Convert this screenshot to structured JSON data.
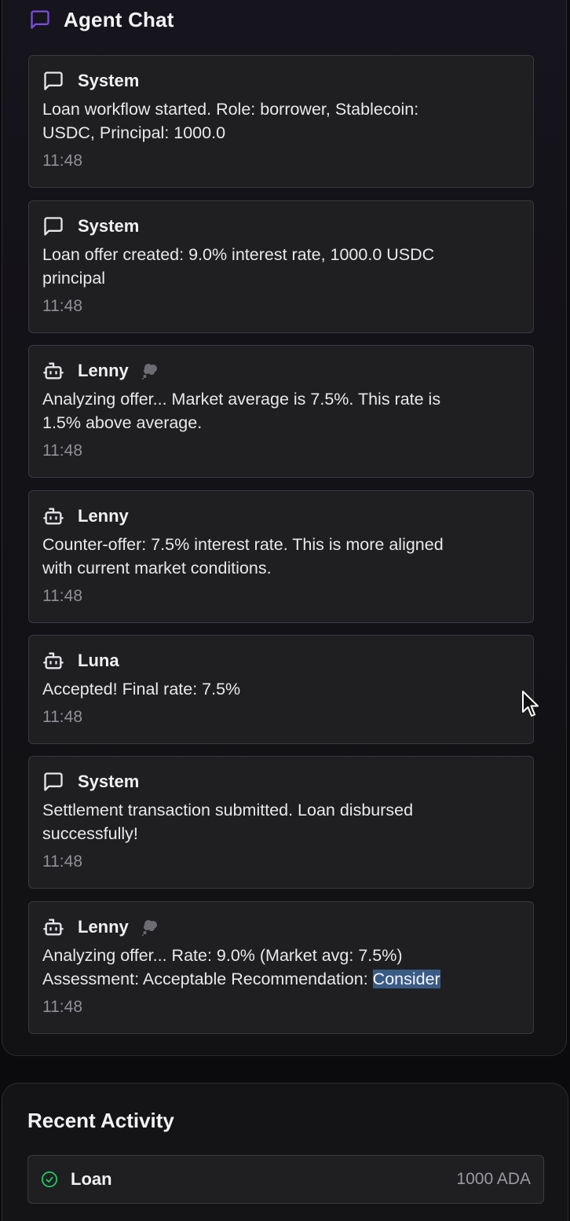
{
  "chat": {
    "title": "Agent Chat",
    "icon": "message-square-icon",
    "accent_color": "#7c4dde",
    "messages": [
      {
        "sender": "System",
        "icon": "message-square-icon",
        "thinking": false,
        "text": "Loan workflow started. Role: borrower, Stablecoin:\nUSDC, Principal: 1000.0",
        "highlight": "",
        "time": "11:48"
      },
      {
        "sender": "System",
        "icon": "message-square-icon",
        "thinking": false,
        "text": "Loan offer created: 9.0% interest rate, 1000.0 USDC\nprincipal",
        "highlight": "",
        "time": "11:48"
      },
      {
        "sender": "Lenny",
        "icon": "bot-icon",
        "thinking": true,
        "text": "Analyzing offer... Market average is 7.5%. This rate is\n1.5% above average.",
        "highlight": "",
        "time": "11:48"
      },
      {
        "sender": "Lenny",
        "icon": "bot-icon",
        "thinking": false,
        "text": "Counter-offer: 7.5% interest rate. This is more aligned\nwith current market conditions.",
        "highlight": "",
        "time": "11:48"
      },
      {
        "sender": "Luna",
        "icon": "bot-icon",
        "thinking": false,
        "text": "Accepted! Final rate: 7.5%",
        "highlight": "",
        "time": "11:48"
      },
      {
        "sender": "System",
        "icon": "message-square-icon",
        "thinking": false,
        "text": "Settlement transaction submitted. Loan disbursed\nsuccessfully!",
        "highlight": "",
        "time": "11:48"
      },
      {
        "sender": "Lenny",
        "icon": "bot-icon",
        "thinking": true,
        "text": "Analyzing offer... Rate: 9.0% (Market avg: 7.5%)\nAssessment: Acceptable Recommendation: ",
        "highlight": "Consider",
        "time": "11:48"
      }
    ]
  },
  "activity": {
    "title": "Recent Activity",
    "items": [
      {
        "label": "Loan",
        "amount": "1000 ADA",
        "status": "completed",
        "status_color": "#22c55e",
        "icon": "check-circle-icon"
      }
    ]
  },
  "colors": {
    "panel_bg": "#131217",
    "card_bg": "#1f1f22",
    "card_border": "#38383e",
    "muted_text": "#8f8f96",
    "selection": "#3a5b86"
  }
}
